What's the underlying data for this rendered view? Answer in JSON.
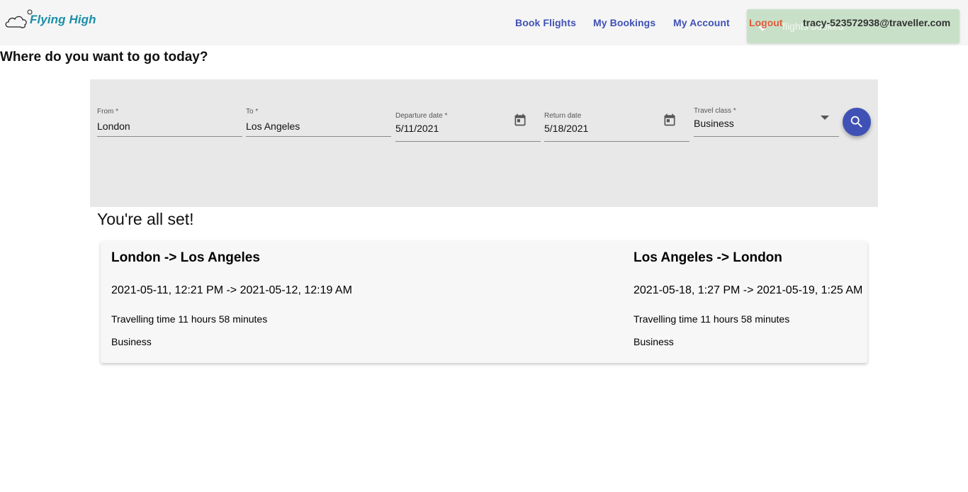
{
  "app": {
    "name": "Flying High"
  },
  "nav": {
    "book_flights": "Book Flights",
    "my_bookings": "My Bookings",
    "my_account": "My Account",
    "logout": "Logout",
    "user_email": "tracy-523572938@traveller.com"
  },
  "toast": {
    "message": "flights booked"
  },
  "headline": "Where do you want to go today?",
  "search": {
    "from": {
      "label": "From *",
      "value": "London"
    },
    "to": {
      "label": "To *",
      "value": "Los Angeles"
    },
    "departure": {
      "label": "Departure date *",
      "value": "5/11/2021"
    },
    "return": {
      "label": "Return date",
      "value": "5/18/2021"
    },
    "travel_class": {
      "label": "Travel class *",
      "value": "Business"
    }
  },
  "confirmation": {
    "title": "You're all set!",
    "outbound": {
      "route": "London -> Los Angeles",
      "times": "2021-05-11, 12:21 PM -> 2021-05-12, 12:19 AM",
      "duration": "Travelling time 11 hours 58 minutes",
      "class": "Business"
    },
    "inbound": {
      "route": "Los Angeles -> London",
      "times": "2021-05-18, 1:27 PM -> 2021-05-19, 1:25 AM",
      "duration": "Travelling time 11 hours 58 minutes",
      "class": "Business"
    }
  },
  "colors": {
    "primary": "#3f51b5",
    "logo": "#1a8fa6",
    "logout": "#e05a3a",
    "toast_bg": "#c8e0c8"
  }
}
